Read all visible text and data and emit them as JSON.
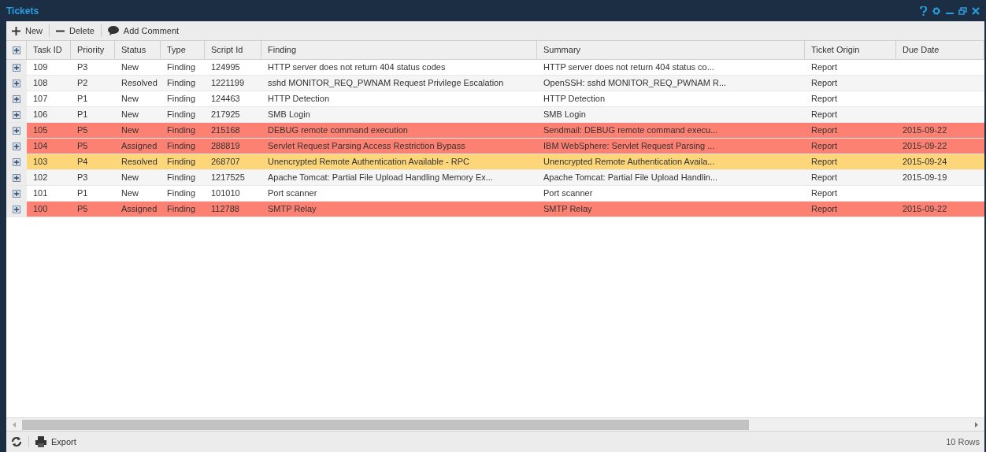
{
  "window": {
    "title": "Tickets"
  },
  "toolbar": [
    {
      "kind": "new",
      "label": "New"
    },
    {
      "kind": "delete",
      "label": "Delete"
    },
    {
      "kind": "comment",
      "label": "Add Comment"
    }
  ],
  "table": {
    "columns": [
      "Task ID",
      "Priority",
      "Status",
      "Type",
      "Script Id",
      "Finding",
      "Summary",
      "Ticket Origin",
      "Due Date"
    ],
    "rows": [
      {
        "cells": [
          "109",
          "P3",
          "New",
          "Finding",
          "124995",
          "HTTP server does not return 404 status codes",
          "HTTP server does not return 404 status co...",
          "Report",
          ""
        ]
      },
      {
        "cells": [
          "108",
          "P2",
          "Resolved",
          "Finding",
          "1221199",
          "sshd MONITOR_REQ_PWNAM Request Privilege Escalation",
          "OpenSSH: sshd MONITOR_REQ_PWNAM R...",
          "Report",
          ""
        ]
      },
      {
        "cells": [
          "107",
          "P1",
          "New",
          "Finding",
          "124463",
          "HTTP Detection",
          "HTTP Detection",
          "Report",
          ""
        ]
      },
      {
        "cells": [
          "106",
          "P1",
          "New",
          "Finding",
          "217925",
          "SMB Login",
          "SMB Login",
          "Report",
          ""
        ]
      },
      {
        "cells": [
          "105",
          "P5",
          "New",
          "Finding",
          "215168",
          "DEBUG remote command execution",
          "Sendmail: DEBUG remote command execu...",
          "Report",
          "2015-09-22"
        ],
        "color": "#fd8173"
      },
      {
        "cells": [
          "104",
          "P5",
          "Assigned",
          "Finding",
          "288819",
          "Servlet Request Parsing Access Restriction Bypass",
          "IBM WebSphere: Servlet Request Parsing ...",
          "Report",
          "2015-09-22"
        ],
        "color": "#fd8173"
      },
      {
        "cells": [
          "103",
          "P4",
          "Resolved",
          "Finding",
          "268707",
          "Unencrypted Remote Authentication Available - RPC",
          "Unencrypted Remote Authentication Availa...",
          "Report",
          "2015-09-24"
        ],
        "color": "#fdd67a"
      },
      {
        "cells": [
          "102",
          "P3",
          "New",
          "Finding",
          "1217525",
          "Apache Tomcat: Partial File Upload Handling Memory Ex...",
          "Apache Tomcat: Partial File Upload Handlin...",
          "Report",
          "2015-09-19"
        ]
      },
      {
        "cells": [
          "101",
          "P1",
          "New",
          "Finding",
          "101010",
          "Port scanner",
          "Port scanner",
          "Report",
          ""
        ]
      },
      {
        "cells": [
          "100",
          "P5",
          "Assigned",
          "Finding",
          "112788",
          "SMTP Relay",
          "SMTP Relay",
          "Report",
          "2015-09-22"
        ],
        "color": "#fd8173"
      }
    ]
  },
  "footer": {
    "export": "Export",
    "row_count": "10 Rows"
  }
}
